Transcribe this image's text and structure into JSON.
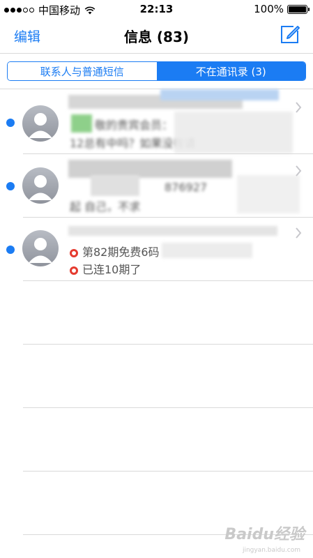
{
  "status_bar": {
    "carrier": "中国移动",
    "time": "22:13",
    "battery_text": "100%",
    "battery_level": 1.0
  },
  "nav": {
    "edit_label": "编辑",
    "title": "信息 (83)",
    "compose_icon": "compose-icon"
  },
  "segments": [
    {
      "label": "联系人与普通短信",
      "selected": false
    },
    {
      "label": "不在通讯录 (3)",
      "selected": true
    }
  ],
  "messages": [
    {
      "unread": true,
      "preview_line1": "敬的贵宾会员：",
      "preview_line2": "12总有中吗？如果没有请",
      "obscured": true
    },
    {
      "unread": true,
      "preview_line1": "876927",
      "preview_line2": "起  自己，不求",
      "obscured": true
    },
    {
      "unread": true,
      "preview_line1": "第82期免费6码",
      "preview_line2": "已连10期了",
      "obscured": false
    }
  ],
  "watermark": {
    "text": "Baidu经验",
    "url_text": "jingyan.baidu.com"
  },
  "colors": {
    "accent": "#1b7cf3",
    "divider": "#d9d9d9",
    "red_ring": "#e53b2f"
  }
}
